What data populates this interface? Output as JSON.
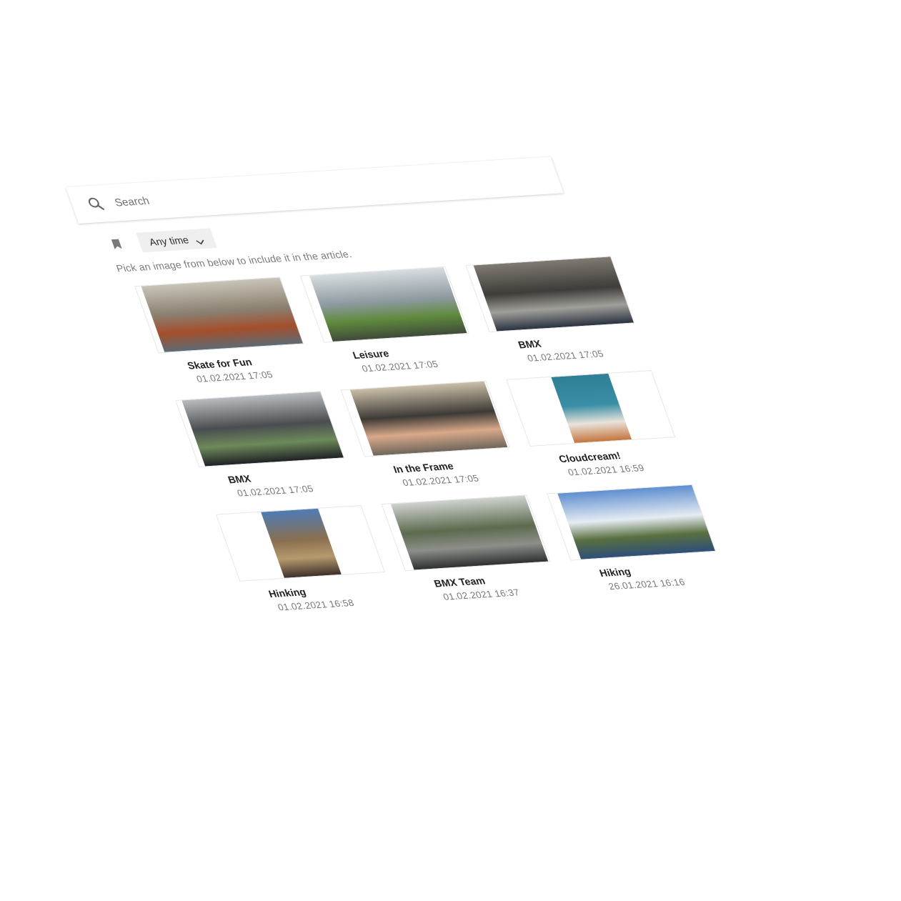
{
  "search": {
    "placeholder": "Search",
    "icon": "search-icon"
  },
  "filters": {
    "bookmark_icon": "bookmark-icon",
    "time_filter": {
      "label": "Any time",
      "icon": "chevron-down-icon"
    }
  },
  "hint": "Pick an image from below to include it in the article.",
  "images": [
    {
      "title": "Skate for Fun",
      "date": "01.02.2021 17:05",
      "palette": [
        "#c9c4b8",
        "#8a7f70",
        "#a44f2c",
        "#5d6b74"
      ]
    },
    {
      "title": "Leisure",
      "date": "01.02.2021 17:05",
      "palette": [
        "#d8dde0",
        "#8d9aa0",
        "#5f8a3c",
        "#3f4a3a"
      ]
    },
    {
      "title": "BMX",
      "date": "01.02.2021 17:05",
      "palette": [
        "#7f7a72",
        "#3f3c39",
        "#a0a09a",
        "#2a3240"
      ]
    },
    {
      "title": "BMX",
      "date": "01.02.2021 17:05",
      "palette": [
        "#b9bcbf",
        "#4a4d50",
        "#6d8a5a",
        "#1f2124"
      ]
    },
    {
      "title": "In the Frame",
      "date": "01.02.2021 17:05",
      "palette": [
        "#c9bea8",
        "#3d3a36",
        "#d9a98a",
        "#6f665b"
      ]
    },
    {
      "title": "Cloudcream!",
      "date": "01.02.2021 16:59",
      "palette": [
        "#2f7f95",
        "#3a8ea6",
        "#e9e3da",
        "#c5743d"
      ]
    },
    {
      "title": "Hinking",
      "date": "01.02.2021 16:58",
      "palette": [
        "#4e7cb5",
        "#8a6f4f",
        "#b69a6e",
        "#3d2f2a"
      ]
    },
    {
      "title": "BMX Team",
      "date": "01.02.2021 16:37",
      "palette": [
        "#cfd2cf",
        "#5c6a4e",
        "#8d8f8a",
        "#2d2f31"
      ]
    },
    {
      "title": "Hiking",
      "date": "26.01.2021 16:16",
      "palette": [
        "#5f8fd0",
        "#e6ecf2",
        "#586f3f",
        "#2f4f7a"
      ]
    }
  ]
}
